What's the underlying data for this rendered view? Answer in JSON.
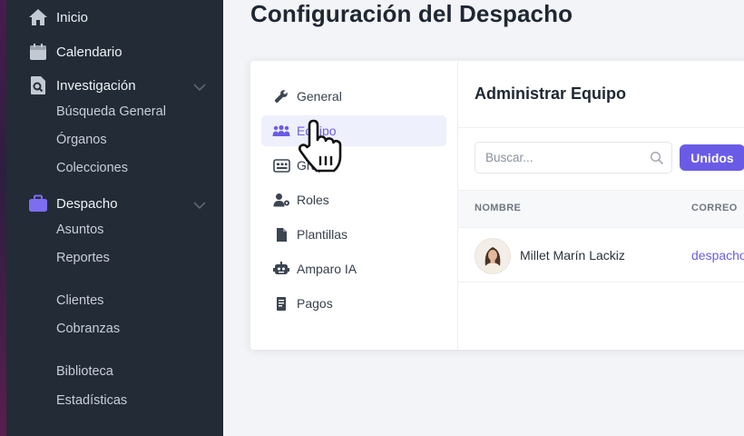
{
  "sidebar": {
    "items": [
      {
        "label": "Inicio",
        "icon": "home-icon"
      },
      {
        "label": "Calendario",
        "icon": "calendar-icon"
      },
      {
        "label": "Investigación",
        "icon": "search-document-icon"
      },
      {
        "label": "Despacho",
        "icon": "briefcase-icon"
      }
    ],
    "investigacion_sub": [
      "Búsqueda General",
      "Órganos",
      "Colecciones"
    ],
    "despacho_sub": [
      "Asuntos",
      "Reportes"
    ],
    "group2": [
      "Clientes",
      "Cobranzas"
    ],
    "group3": [
      "Biblioteca",
      "Estadísticas"
    ]
  },
  "page": {
    "title": "Configuración del Despacho"
  },
  "settings_menu": {
    "items": [
      {
        "label": "General",
        "icon": "wrench-icon"
      },
      {
        "label": "Equipo",
        "icon": "team-icon",
        "active": true
      },
      {
        "label": "Grupos",
        "icon": "id-card-icon"
      },
      {
        "label": "Roles",
        "icon": "user-role-icon"
      },
      {
        "label": "Plantillas",
        "icon": "file-icon"
      },
      {
        "label": "Amparo IA",
        "icon": "robot-icon"
      },
      {
        "label": "Pagos",
        "icon": "receipt-icon"
      }
    ]
  },
  "panel": {
    "title": "Administrar Equipo",
    "search_placeholder": "Buscar...",
    "filter_button": "Unidos",
    "columns": [
      "NOMBRE",
      "CORREO"
    ],
    "rows": [
      {
        "name": "Millet Marín Lackiz",
        "email": "despacho"
      }
    ]
  },
  "colors": {
    "sidebar_bg": "#232b36",
    "accent": "#6a5be7",
    "page_bg": "#f3f4f7"
  }
}
